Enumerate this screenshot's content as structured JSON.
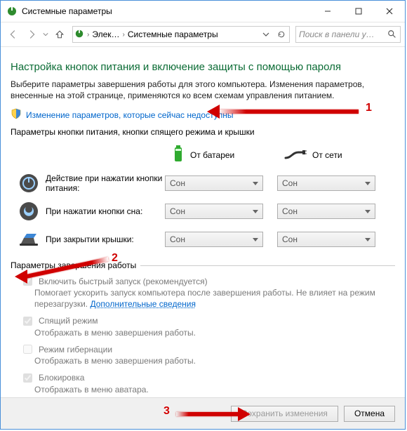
{
  "window": {
    "title": "Системные параметры"
  },
  "nav": {
    "addr_icon": "power-options-icon",
    "crumb1": "Элек…",
    "crumb2": "Системные параметры",
    "search_placeholder": "Поиск в панели у…"
  },
  "page_title": "Настройка кнопок питания и включение защиты с помощью пароля",
  "intro": "Выберите параметры завершения работы для этого компьютера. Изменения параметров, внесенные на этой странице, применяются ко всем схемам управления питанием.",
  "change_unavailable_link": "Изменение параметров, которые сейчас недоступны",
  "section1_label": "Параметры кнопки питания, кнопки спящего режима и крышки",
  "columns": {
    "battery": "От батареи",
    "ac": "От сети"
  },
  "rows": {
    "power_button": {
      "label": "Действие при нажатии кнопки питания:",
      "battery": "Сон",
      "ac": "Сон"
    },
    "sleep_button": {
      "label": "При нажатии кнопки сна:",
      "battery": "Сон",
      "ac": "Сон"
    },
    "lid_close": {
      "label": "При закрытии крышки:",
      "battery": "Сон",
      "ac": "Сон"
    }
  },
  "shutdown_group_label": "Параметры завершения работы",
  "options": {
    "fast_startup": {
      "title": "Включить быстрый запуск (рекомендуется)",
      "desc1": "Помогает ускорить запуск компьютера после завершения работы. Не влияет на режим перезагрузки. ",
      "more_link": "Дополнительные сведения"
    },
    "sleep": {
      "title": "Спящий режим",
      "desc": "Отображать в меню завершения работы."
    },
    "hibernate": {
      "title": "Режим гибернации",
      "desc": "Отображать в меню завершения работы."
    },
    "lock": {
      "title": "Блокировка",
      "desc": "Отображать в меню аватара."
    }
  },
  "buttons": {
    "save": "Сохранить изменения",
    "cancel": "Отмена"
  },
  "annotations": {
    "n1": "1",
    "n2": "2",
    "n3": "3"
  }
}
